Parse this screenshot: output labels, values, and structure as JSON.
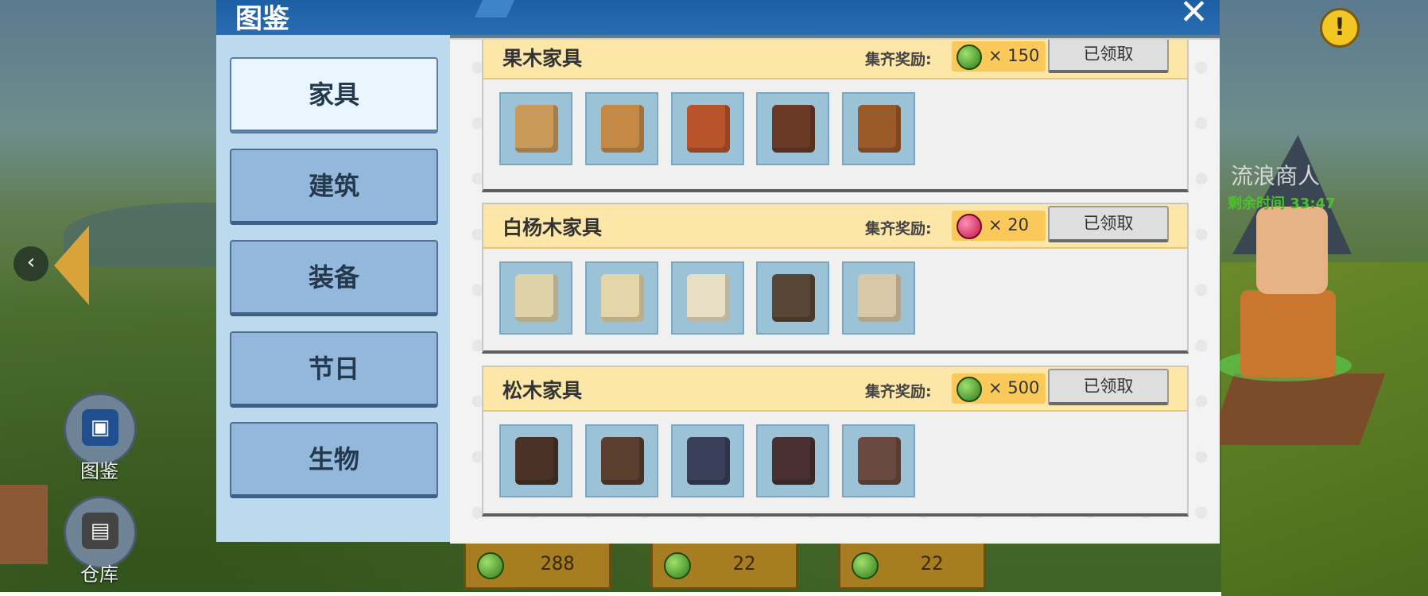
{
  "dialog": {
    "title": "图鉴",
    "close_label": "✕"
  },
  "hud": {
    "warning_glyph": "!",
    "back_glyph": "‹",
    "side_buttons": [
      {
        "label": "图鉴",
        "icon": "book-icon"
      },
      {
        "label": "仓库",
        "icon": "backpack-icon"
      }
    ],
    "merchant": {
      "name": "流浪商人",
      "time_label": "剩余时间 33:47"
    },
    "currency": [
      {
        "icon": "green-gem-icon",
        "amount": "288"
      },
      {
        "icon": "green-gem-icon",
        "amount": "22"
      },
      {
        "icon": "green-gem-icon",
        "amount": "22"
      }
    ]
  },
  "categories": [
    {
      "label": "家具",
      "active": true
    },
    {
      "label": "建筑",
      "active": false
    },
    {
      "label": "装备",
      "active": false
    },
    {
      "label": "节日",
      "active": false
    },
    {
      "label": "生物",
      "active": false
    }
  ],
  "sets": [
    {
      "name": "果木家具",
      "reward_label": "集齐奖励:",
      "reward_icon": "green-gem-icon",
      "reward_qty": "× 150",
      "claim_label": "已领取",
      "item_colors": [
        "#c99a5a",
        "#c48a45",
        "#b8532a",
        "#6a3a26",
        "#9a5a2a"
      ]
    },
    {
      "name": "白杨木家具",
      "reward_label": "集齐奖励:",
      "reward_icon": "lips-icon",
      "reward_qty": "× 20",
      "claim_label": "已领取",
      "item_colors": [
        "#e0d2a8",
        "#e4d6a8",
        "#e8e0c4",
        "#5a4636",
        "#d8c8a8"
      ]
    },
    {
      "name": "松木家具",
      "reward_label": "集齐奖励:",
      "reward_icon": "green-gem-icon",
      "reward_qty": "× 500",
      "claim_label": "已领取",
      "item_colors": [
        "#4a3226",
        "#5a3e2e",
        "#3a3f5a",
        "#4a3030",
        "#6a4a40"
      ]
    }
  ],
  "colors": {
    "title_bar": "#1c5fa3",
    "category_button": "#93b8dc",
    "set_header": "#fce6a8",
    "reward_chip": "#fbc959"
  }
}
